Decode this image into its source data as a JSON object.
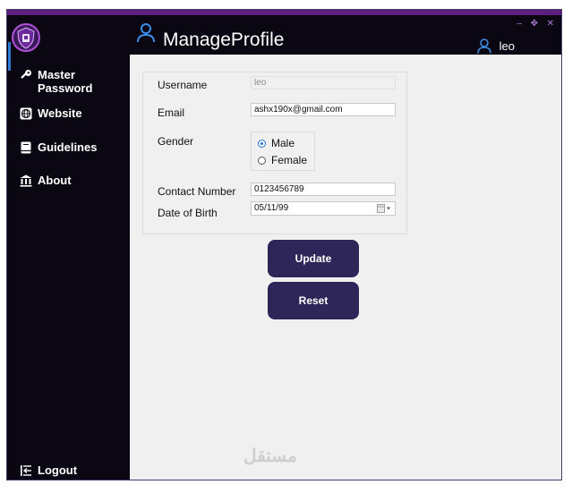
{
  "header": {
    "title": "ManageProfile",
    "user_name": "leo"
  },
  "window_controls": {
    "minimize": "–",
    "maximize": "✥",
    "close": "✕"
  },
  "sidebar": {
    "items": [
      {
        "label_line1": "Master",
        "label_line2": "Password",
        "icon": "key-icon"
      },
      {
        "label": "Website",
        "icon": "globe-icon"
      },
      {
        "label": "Guidelines",
        "icon": "book-icon"
      },
      {
        "label": "About",
        "icon": "bank-icon"
      }
    ],
    "logout_label": "Logout"
  },
  "form": {
    "username_label": "Username",
    "username_value": "leo",
    "email_label": "Email",
    "email_value": "ashx190x@gmail.com",
    "gender_label": "Gender",
    "gender_options": [
      "Male",
      "Female"
    ],
    "gender_selected": "Male",
    "contact_label": "Contact Number",
    "contact_value": "0123456789",
    "dob_label": "Date of Birth",
    "dob_value": "05/11/99"
  },
  "buttons": {
    "update": "Update",
    "reset": "Reset"
  },
  "watermark": "مستقل",
  "colors": {
    "sidebar_bg": "#0a0712",
    "accent_purple": "#5c1f82",
    "button_bg": "#2e2558",
    "content_bg": "#f0f0f0"
  }
}
